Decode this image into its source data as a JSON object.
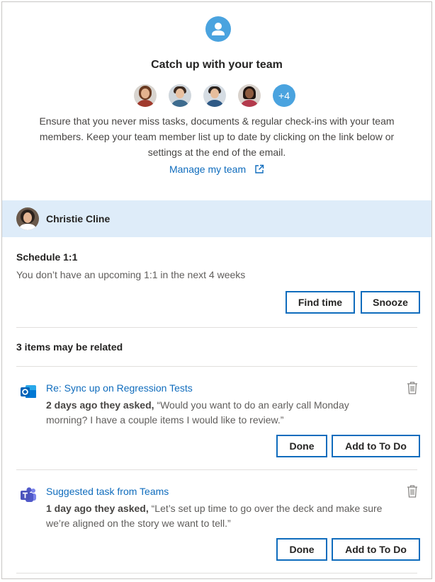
{
  "header": {
    "logo_icon": "person-circle-icon",
    "title": "Catch up with your team",
    "avatars": [
      {
        "name": "team-member-1",
        "skin": "#e3b38f",
        "hair": "#6a3b22",
        "shirt": "#a03a2d"
      },
      {
        "name": "team-member-2",
        "skin": "#e8c0a0",
        "hair": "#3b2a20",
        "shirt": "#3d6b8e"
      },
      {
        "name": "team-member-3",
        "skin": "#e6bd9c",
        "hair": "#2c2420",
        "shirt": "#2f5a86"
      },
      {
        "name": "team-member-4",
        "skin": "#8d5a3e",
        "hair": "#1f1410",
        "shirt": "#b33a4c"
      }
    ],
    "more_count": "+4",
    "description": "Ensure that you never miss tasks, documents & regular check-ins with your team members. Keep your team member list up to date by clicking on the link below or settings at the end of the email.",
    "manage_link": "Manage my team",
    "manage_icon": "external-link-icon"
  },
  "person": {
    "name": "Christie Cline"
  },
  "schedule": {
    "title": "Schedule 1:1",
    "text": "You don’t have an upcoming 1:1 in the next 4 weeks",
    "find_time_label": "Find time",
    "snooze_label": "Snooze"
  },
  "related": {
    "title": "3 items may be related",
    "items": [
      {
        "icon": "outlook-icon",
        "link": "Re: Sync up on Regression Tests",
        "prefix": "2 days ago they asked,",
        "quote": " “Would you want to do an early call Monday morning? I have a couple items I would like to review.”",
        "done_label": "Done",
        "todo_label": "Add to To Do"
      },
      {
        "icon": "teams-icon",
        "link": "Suggested task from Teams",
        "prefix": "1 day ago they asked,",
        "quote": " “Let’s set up time to go over the deck and make sure we’re aligned on the story we want to tell.”",
        "done_label": "Done",
        "todo_label": "Add to To Do"
      }
    ]
  },
  "colors": {
    "accent": "#0f6cbd",
    "badge": "#4aa3df",
    "person_bar": "#deecf9"
  }
}
